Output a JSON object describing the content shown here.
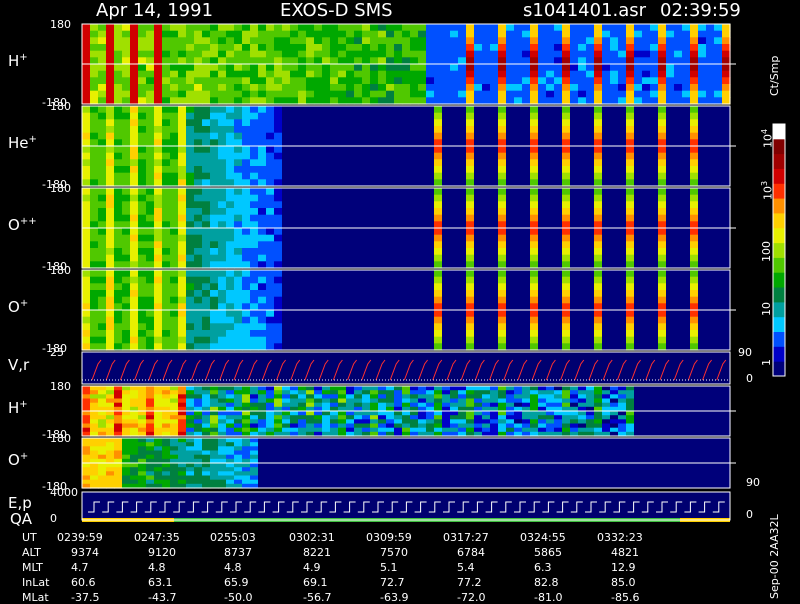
{
  "header": {
    "date": "Apr 14, 1991",
    "instrument": "EXOS-D SMS",
    "file": "s1041401.asr",
    "time": "02:39:59"
  },
  "panels": [
    {
      "id": "h1",
      "label": "H",
      "sup": "+",
      "ymax": "180",
      "ymin": "-180"
    },
    {
      "id": "he",
      "label": "He",
      "sup": "+",
      "ymax": "180",
      "ymin": "-180"
    },
    {
      "id": "opp",
      "label": "O",
      "sup": "++",
      "ymax": "180",
      "ymin": "-180"
    },
    {
      "id": "op1",
      "label": "O",
      "sup": "+",
      "ymax": "180",
      "ymin": "-180"
    },
    {
      "id": "vr",
      "label": "V,r",
      "sup": "",
      "ymax": "25",
      "ymin": "",
      "right_top": "90",
      "right_bottom": "0"
    },
    {
      "id": "h2",
      "label": "H",
      "sup": "+",
      "ymax": "180",
      "ymin": "-180"
    },
    {
      "id": "op2",
      "label": "O",
      "sup": "+",
      "ymax": "180",
      "ymin": "-180",
      "right_bottom": "90"
    },
    {
      "id": "ep",
      "label": "E,p",
      "sup": "",
      "ymax": "4000",
      "ymin": "0",
      "right_bottom": "0"
    }
  ],
  "qa_label": "QA",
  "colorbar": {
    "unit": "Ct/Smp",
    "labels": {
      "1e4": "10",
      "1e4_exp": "4",
      "1e3": "10",
      "1e3_exp": "3",
      "100": "100",
      "10": "10",
      "1": "1"
    },
    "colors": [
      "#00007a",
      "#0000c8",
      "#0050ff",
      "#00c8ff",
      "#00a0a0",
      "#008040",
      "#00a800",
      "#50c800",
      "#a0e000",
      "#e8f000",
      "#ffd000",
      "#ff9000",
      "#ff3000",
      "#d00000",
      "#a00000",
      "#800000",
      "#ffffff"
    ]
  },
  "chart_data": {
    "type": "heatmap",
    "title": "Apr 14, 1991 EXOS-D SMS",
    "species_panels": [
      "H+",
      "He+",
      "O++",
      "O+",
      "V,r",
      "H+",
      "O+",
      "E,p"
    ],
    "ylim_pitch": [
      -180,
      180
    ],
    "ylim_vr": [
      0,
      25
    ],
    "ylim_ep": [
      0,
      4000
    ],
    "color_scale": "log",
    "color_range": [
      1,
      10000
    ],
    "x_ticks": [
      "0239:59",
      "0247:35",
      "0255:03",
      "0302:31",
      "0309:59",
      "0317:27",
      "0324:55",
      "0332:23"
    ]
  },
  "ephemeris": {
    "rows": [
      {
        "name": "UT",
        "values": [
          "0239:59",
          "0247:35",
          "0255:03",
          "0302:31",
          "0309:59",
          "0317:27",
          "0324:55",
          "0332:23"
        ]
      },
      {
        "name": "ALT",
        "values": [
          "9374",
          "9120",
          "8737",
          "8221",
          "7570",
          "6784",
          "5865",
          "4821"
        ]
      },
      {
        "name": "MLT",
        "values": [
          "4.7",
          "4.8",
          "4.8",
          "4.9",
          "5.1",
          "5.4",
          "6.3",
          "12.9"
        ]
      },
      {
        "name": "InLat",
        "values": [
          "60.6",
          "63.1",
          "65.9",
          "69.1",
          "72.7",
          "77.2",
          "82.8",
          "85.0"
        ]
      },
      {
        "name": "MLat",
        "values": [
          "-37.5",
          "-43.7",
          "-50.0",
          "-56.7",
          "-63.9",
          "-72.0",
          "-81.0",
          "-85.6"
        ]
      }
    ]
  },
  "version_stamp": "Sep-00 2AA32L"
}
